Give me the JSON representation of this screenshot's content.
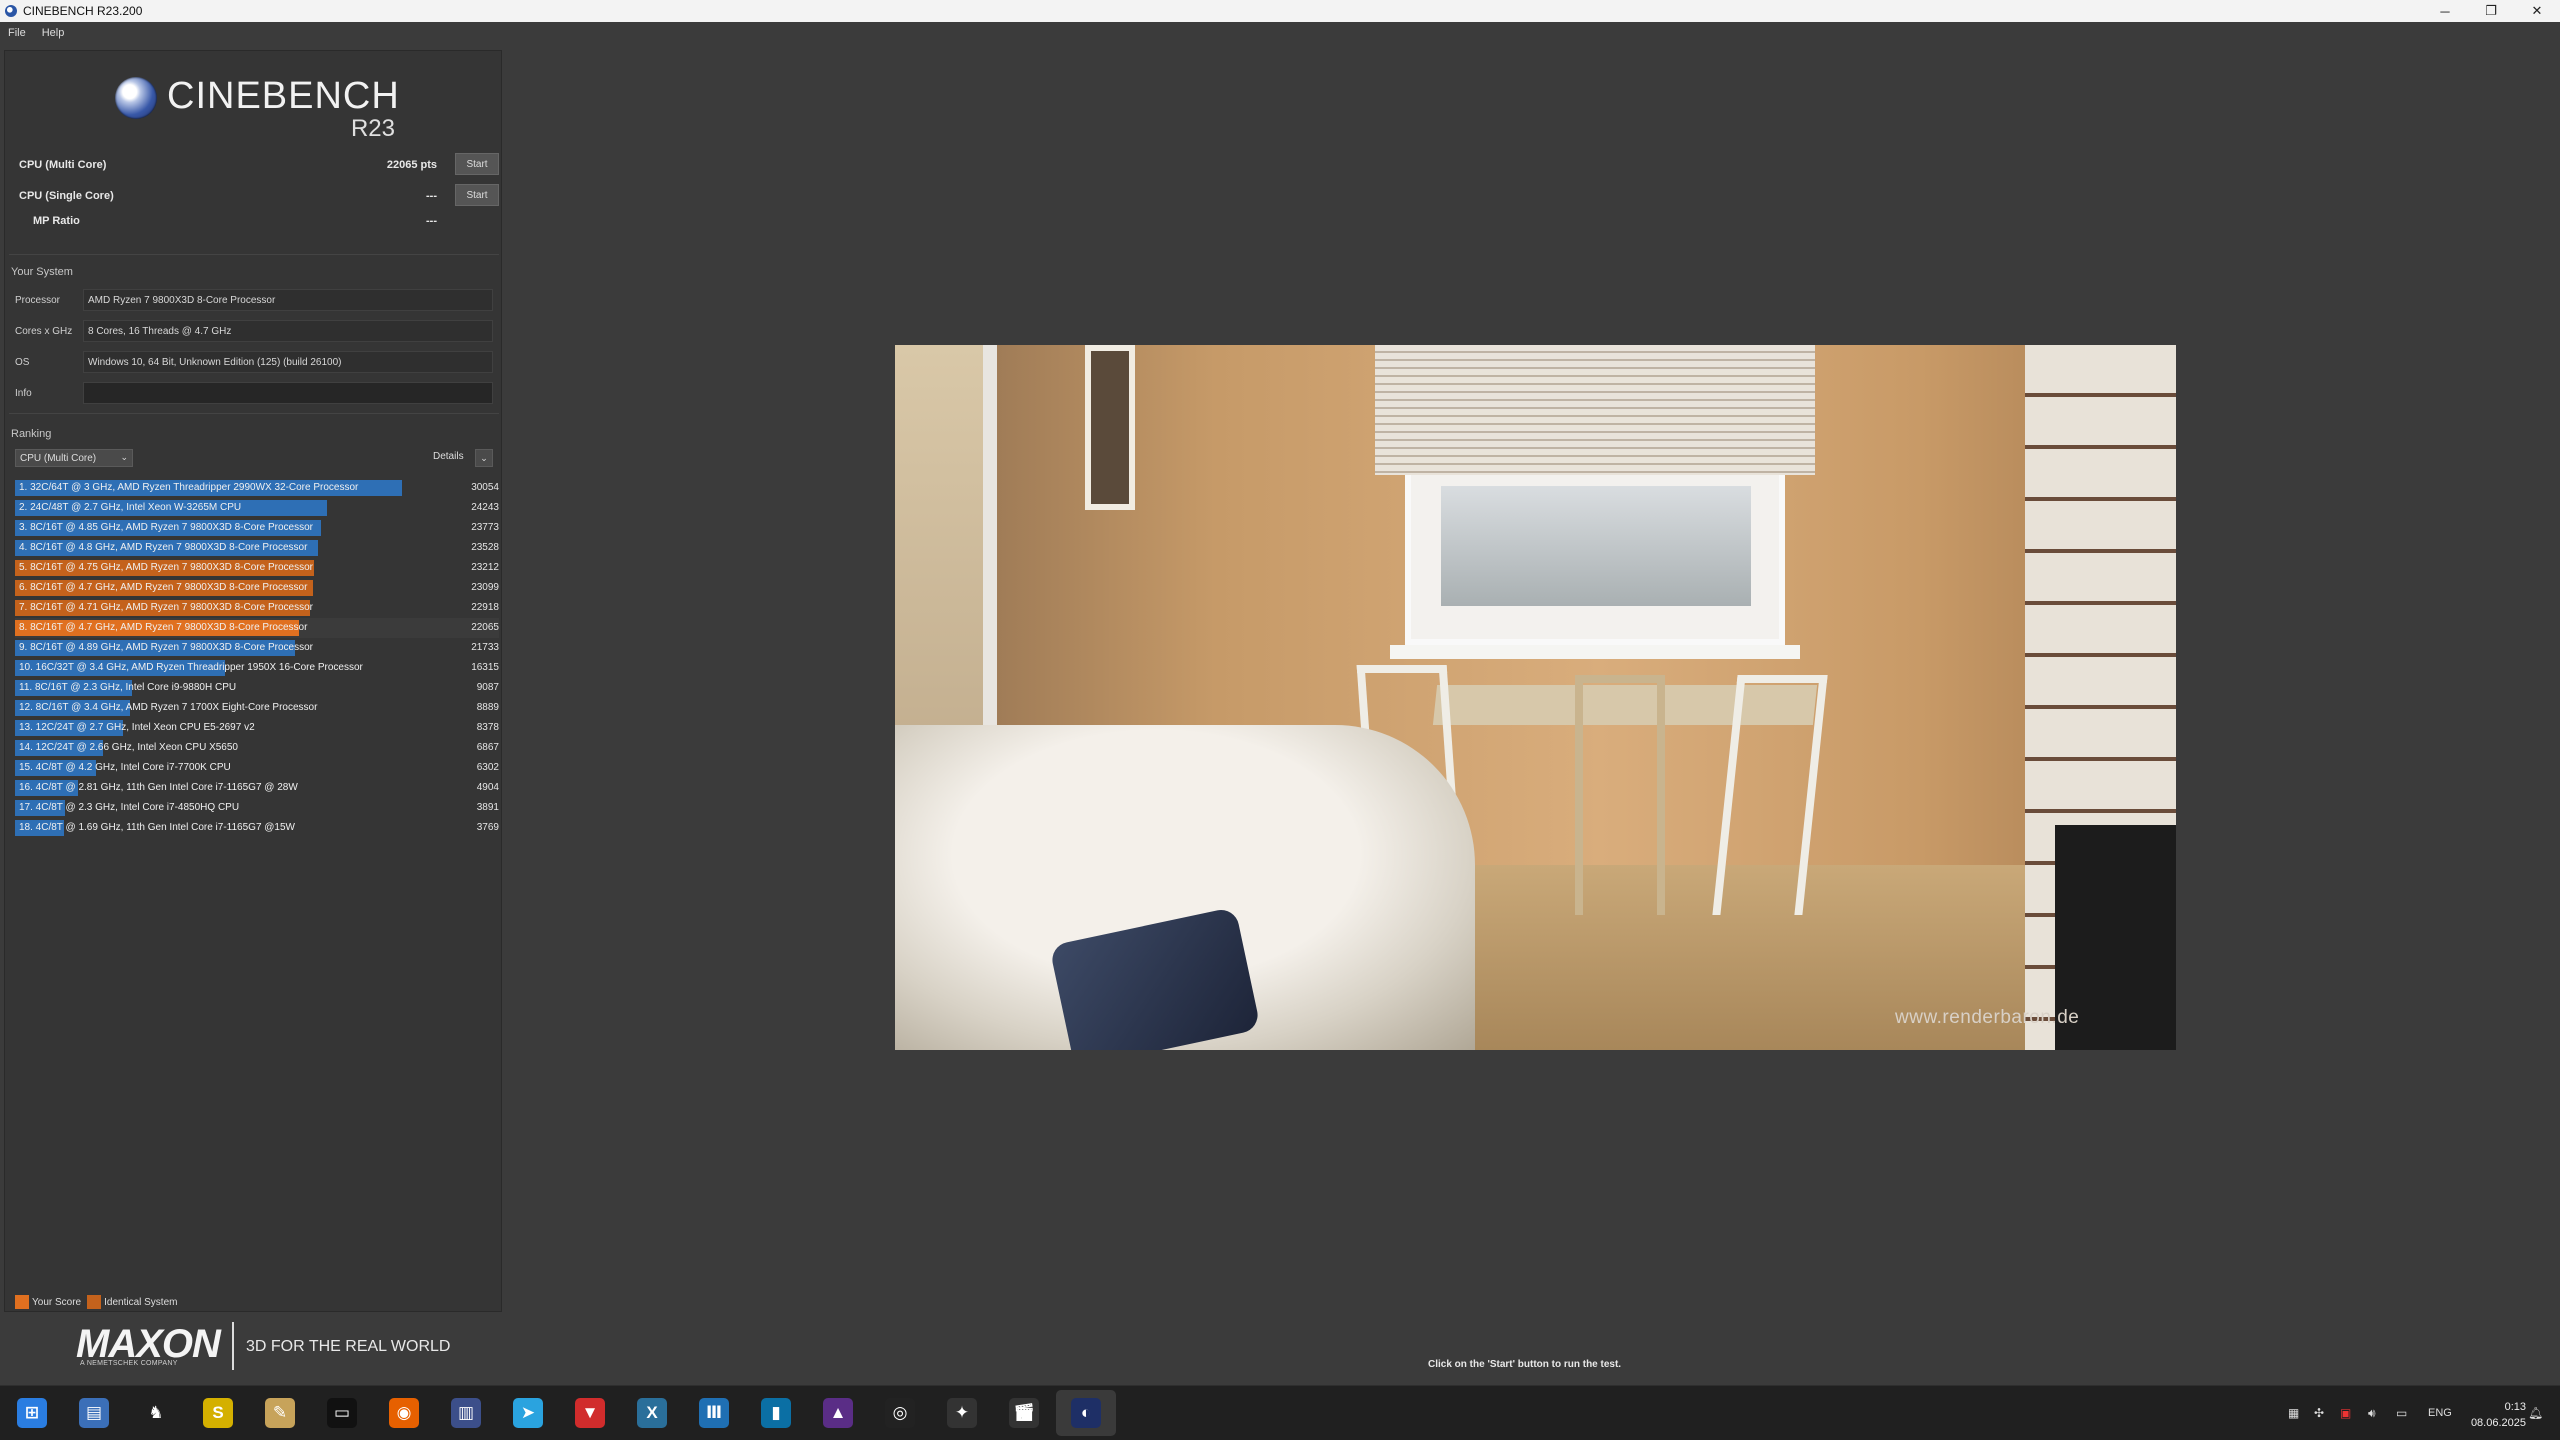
{
  "window": {
    "title": "CINEBENCH R23.200",
    "minimize": "─",
    "restore": "❐",
    "close": "✕"
  },
  "menu": [
    "File",
    "Help"
  ],
  "logo": {
    "word": "CINEBENCH",
    "version": "R23"
  },
  "benchmarks": {
    "multi_label": "CPU (Multi Core)",
    "multi_value": "22065 pts",
    "multi_start": "Start",
    "single_label": "CPU (Single Core)",
    "single_value": "---",
    "single_start": "Start",
    "mp_label": "MP Ratio",
    "mp_value": "---"
  },
  "system": {
    "title": "Your System",
    "processor_label": "Processor",
    "processor": "AMD Ryzen 7 9800X3D 8-Core Processor",
    "cores_label": "Cores x GHz",
    "cores": "8 Cores, 16 Threads @ 4.7 GHz",
    "os_label": "OS",
    "os": "Windows 10, 64 Bit, Unknown Edition (125) (build 26100)",
    "info_label": "Info",
    "info": ""
  },
  "ranking": {
    "title": "Ranking",
    "dropdown": "CPU (Multi Core)",
    "details": "Details",
    "max_score": 30054,
    "colors": {
      "blue": "#2e6fb5",
      "orange": "#c4621c",
      "self": "#e07020"
    },
    "rows": [
      {
        "label": "1. 32C/64T @ 3 GHz, AMD Ryzen Threadripper 2990WX 32-Core Processor",
        "score": 30054,
        "kind": "blue"
      },
      {
        "label": "2. 24C/48T @ 2.7 GHz, Intel Xeon W-3265M CPU",
        "score": 24243,
        "kind": "blue"
      },
      {
        "label": "3. 8C/16T @ 4.85 GHz, AMD Ryzen 7 9800X3D 8-Core Processor",
        "score": 23773,
        "kind": "blue"
      },
      {
        "label": "4. 8C/16T @ 4.8 GHz, AMD Ryzen 7 9800X3D 8-Core Processor",
        "score": 23528,
        "kind": "blue"
      },
      {
        "label": "5. 8C/16T @ 4.75 GHz, AMD Ryzen 7 9800X3D 8-Core Processor",
        "score": 23212,
        "kind": "orange"
      },
      {
        "label": "6. 8C/16T @ 4.7 GHz, AMD Ryzen 7 9800X3D 8-Core Processor",
        "score": 23099,
        "kind": "orange"
      },
      {
        "label": "7. 8C/16T @ 4.71 GHz, AMD Ryzen 7 9800X3D 8-Core Processor",
        "score": 22918,
        "kind": "orange"
      },
      {
        "label": "8. 8C/16T @ 4.7 GHz, AMD Ryzen 7 9800X3D 8-Core Processor",
        "score": 22065,
        "kind": "self"
      },
      {
        "label": "9. 8C/16T @ 4.89 GHz, AMD Ryzen 7 9800X3D 8-Core Processor",
        "score": 21733,
        "kind": "blue"
      },
      {
        "label": "10. 16C/32T @ 3.4 GHz, AMD Ryzen Threadripper 1950X 16-Core Processor",
        "score": 16315,
        "kind": "blue"
      },
      {
        "label": "11. 8C/16T @ 2.3 GHz, Intel Core i9-9880H CPU",
        "score": 9087,
        "kind": "blue"
      },
      {
        "label": "12. 8C/16T @ 3.4 GHz, AMD Ryzen 7 1700X Eight-Core Processor",
        "score": 8889,
        "kind": "blue"
      },
      {
        "label": "13. 12C/24T @ 2.7 GHz, Intel Xeon CPU E5-2697 v2",
        "score": 8378,
        "kind": "blue"
      },
      {
        "label": "14. 12C/24T @ 2.66 GHz, Intel Xeon CPU X5650",
        "score": 6867,
        "kind": "blue"
      },
      {
        "label": "15. 4C/8T @ 4.2 GHz, Intel Core i7-7700K CPU",
        "score": 6302,
        "kind": "blue"
      },
      {
        "label": "16. 4C/8T @ 2.81 GHz, 11th Gen Intel Core i7-1165G7 @ 28W",
        "score": 4904,
        "kind": "blue"
      },
      {
        "label": "17. 4C/8T @ 2.3 GHz, Intel Core i7-4850HQ CPU",
        "score": 3891,
        "kind": "blue"
      },
      {
        "label": "18. 4C/8T @ 1.69 GHz, 11th Gen Intel Core i7-1165G7 @15W",
        "score": 3769,
        "kind": "blue"
      }
    ]
  },
  "legend": {
    "your_score": "Your Score",
    "identical": "Identical System",
    "your_color": "#e07020",
    "identical_color": "#c4621c"
  },
  "maxon": {
    "name": "MAXON",
    "sub": "A NEMETSCHEK COMPANY",
    "tagline": "3D FOR THE REAL WORLD"
  },
  "render": {
    "watermark": "www.renderbaron.de"
  },
  "status": "Click on the 'Start' button to run the test.",
  "taskbar": {
    "icons": [
      "start-icon",
      "file-explorer-icon",
      "wolf-app-icon",
      "s-app-icon",
      "pen-app-icon",
      "terminal-icon",
      "firefox-icon",
      "notepad-icon",
      "telegram-icon",
      "red-app-icon",
      "x-app-icon",
      "equalizer-app-icon",
      "blue-app-icon",
      "purple-app-icon",
      "obs-icon",
      "clock-app-icon",
      "clapper-icon",
      "cinebench-icon"
    ],
    "lang": "ENG",
    "time": "0:13",
    "date": "08.06.2025"
  }
}
